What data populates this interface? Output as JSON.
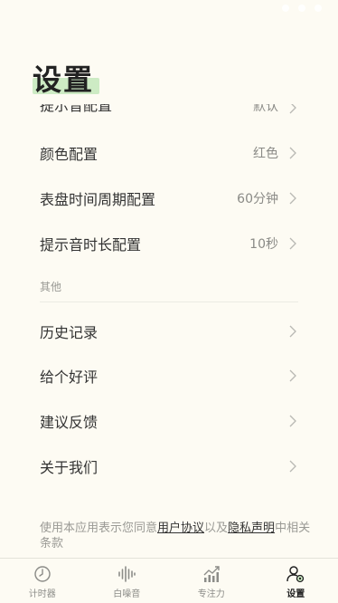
{
  "title": "设置",
  "settings_rows": [
    {
      "label": "提示音配置",
      "value": "默认"
    },
    {
      "label": "颜色配置",
      "value": "红色"
    },
    {
      "label": "表盘时间周期配置",
      "value": "60分钟"
    },
    {
      "label": "提示音时长配置",
      "value": "10秒"
    }
  ],
  "other_section": {
    "header": "其他",
    "rows": [
      {
        "label": "历史记录"
      },
      {
        "label": "给个好评"
      },
      {
        "label": "建议反馈"
      },
      {
        "label": "关于我们"
      }
    ]
  },
  "footer": {
    "prefix": "使用本应用表示您同意",
    "user_agreement": "用户协议",
    "middle": "以及",
    "privacy": "隐私声明",
    "suffix": "中相关条款"
  },
  "tabs": [
    {
      "label": "计时器",
      "icon": "clock-icon"
    },
    {
      "label": "白噪音",
      "icon": "soundwave-icon"
    },
    {
      "label": "专注力",
      "icon": "chart-icon"
    },
    {
      "label": "设置",
      "icon": "user-settings-icon",
      "active": true
    }
  ],
  "colors": {
    "background": "#fdfbf3",
    "title_highlight": "#cdebc4"
  }
}
